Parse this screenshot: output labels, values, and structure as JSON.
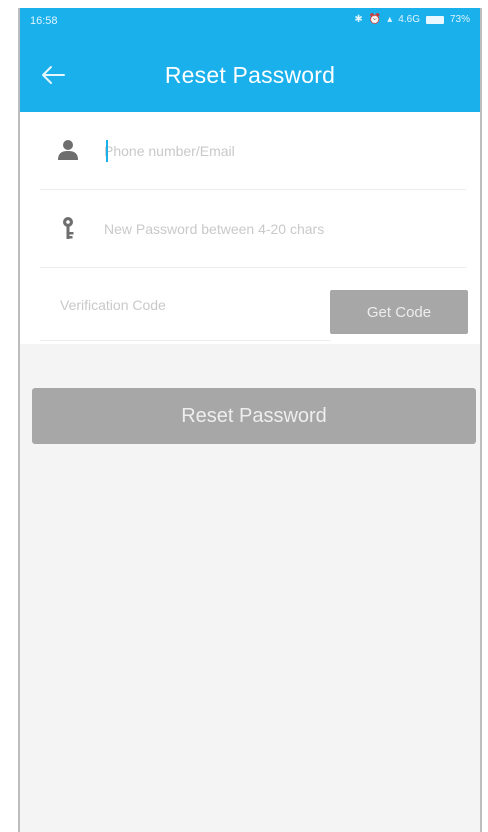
{
  "status_bar": {
    "time": "16:58",
    "network": "4.6G",
    "battery": "73%"
  },
  "header": {
    "title": "Reset Password",
    "back_icon": "arrow-left-icon",
    "background_color": "#1ab0ec"
  },
  "form": {
    "account": {
      "placeholder": "Phone number/Email",
      "value": "",
      "icon": "person-icon"
    },
    "new_password": {
      "placeholder": "New Password between 4-20 chars",
      "value": "",
      "icon": "key-icon"
    },
    "verification_code": {
      "placeholder": "Verification Code",
      "value": ""
    },
    "get_code_label": "Get Code"
  },
  "submit": {
    "label": "Reset Password"
  },
  "colors": {
    "accent": "#1ab0ec",
    "disabled_button": "#a7a7a7"
  }
}
